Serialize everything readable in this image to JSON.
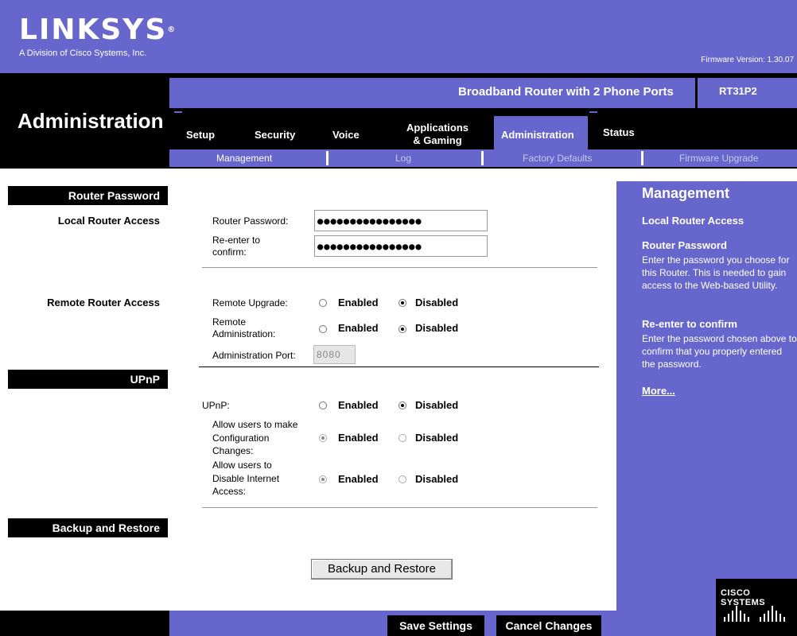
{
  "header": {
    "logo": "LINKSYS",
    "logo_mark": "®",
    "logo_sub": "A Division of Cisco Systems, Inc.",
    "firmware": "Firmware Version: 1.30.07",
    "product_name": "Broadband Router with 2 Phone Ports",
    "model": "RT31P2",
    "page_title": "Administration"
  },
  "tabs": [
    {
      "label": "Setup"
    },
    {
      "label": "Security"
    },
    {
      "label": "Voice"
    },
    {
      "label": "Applications\n& Gaming"
    },
    {
      "label": "Administration"
    },
    {
      "label": "Status"
    }
  ],
  "subtabs": [
    {
      "label": "Management"
    },
    {
      "label": "Log"
    },
    {
      "label": "Factory Defaults"
    },
    {
      "label": "Firmware Upgrade"
    }
  ],
  "left": {
    "router_password": "Router Password",
    "local_router_access": "Local Router Access",
    "remote_router_access": "Remote Router Access",
    "upnp": "UPnP",
    "backup_restore": "Backup and Restore"
  },
  "form": {
    "router_password_label": "Router Password:",
    "router_password_value": "●●●●●●●●●●●●●●●●",
    "reenter_label": "Re-enter to\nconfirm:",
    "reenter_value": "●●●●●●●●●●●●●●●●",
    "remote_upgrade_label": "Remote Upgrade:",
    "remote_admin_label": "Remote\nAdministration:",
    "admin_port_label": "Administration Port:",
    "admin_port_value": "8080",
    "upnp_label": "UPnP:",
    "allow_config_label": "Allow users to make\nConfiguration\nChanges:",
    "allow_disable_label": "Allow users to\nDisable Internet\nAccess:",
    "enabled": "Enabled",
    "disabled": "Disabled",
    "backup_button": "Backup and Restore"
  },
  "help": {
    "title": "Management",
    "local_access": "Local Router Access",
    "router_password_head": "Router Password",
    "router_password_text": "Enter the password you choose for this Router. This is needed to gain access to the Web-based Utility.",
    "reenter_head": "Re-enter to confirm",
    "reenter_text": "Enter the password chosen above to confirm that you properly entered the password.",
    "more": "More..."
  },
  "footer": {
    "save": "Save Settings",
    "cancel": "Cancel Changes",
    "cisco": "CISCO SYSTEMS"
  }
}
